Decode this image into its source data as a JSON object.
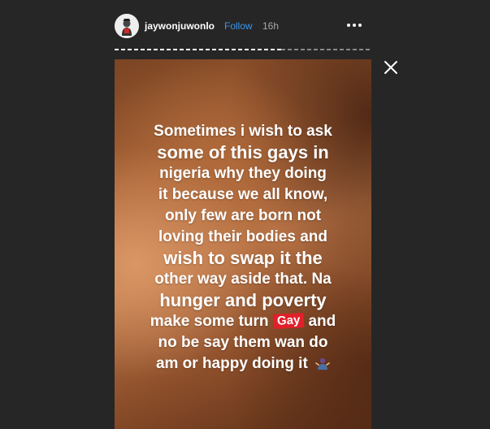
{
  "header": {
    "username": "jaywonjuwonlo",
    "separator": "•",
    "follow_label": "Follow",
    "time_ago": "16h",
    "more_icon": "more-horizontal-icon"
  },
  "progress": {
    "current_segment_fraction": 0.65
  },
  "close_icon": "close-icon",
  "story": {
    "lines": [
      "Sometimes i wish to ask",
      "some of this gays in",
      "nigeria why they doing",
      "it because we all know,",
      "only few are born not",
      "loving their bodies and",
      "wish to swap it the",
      "other way aside that. Na",
      "hunger and poverty",
      "make some turn",
      "and",
      "no be say them wan do",
      "am or happy doing it"
    ],
    "sticker_label": "Gay",
    "emoji": "person-shrugging-emoji"
  },
  "colors": {
    "background": "#262626",
    "follow": "#3897f0",
    "sticker": "#e0202a"
  }
}
